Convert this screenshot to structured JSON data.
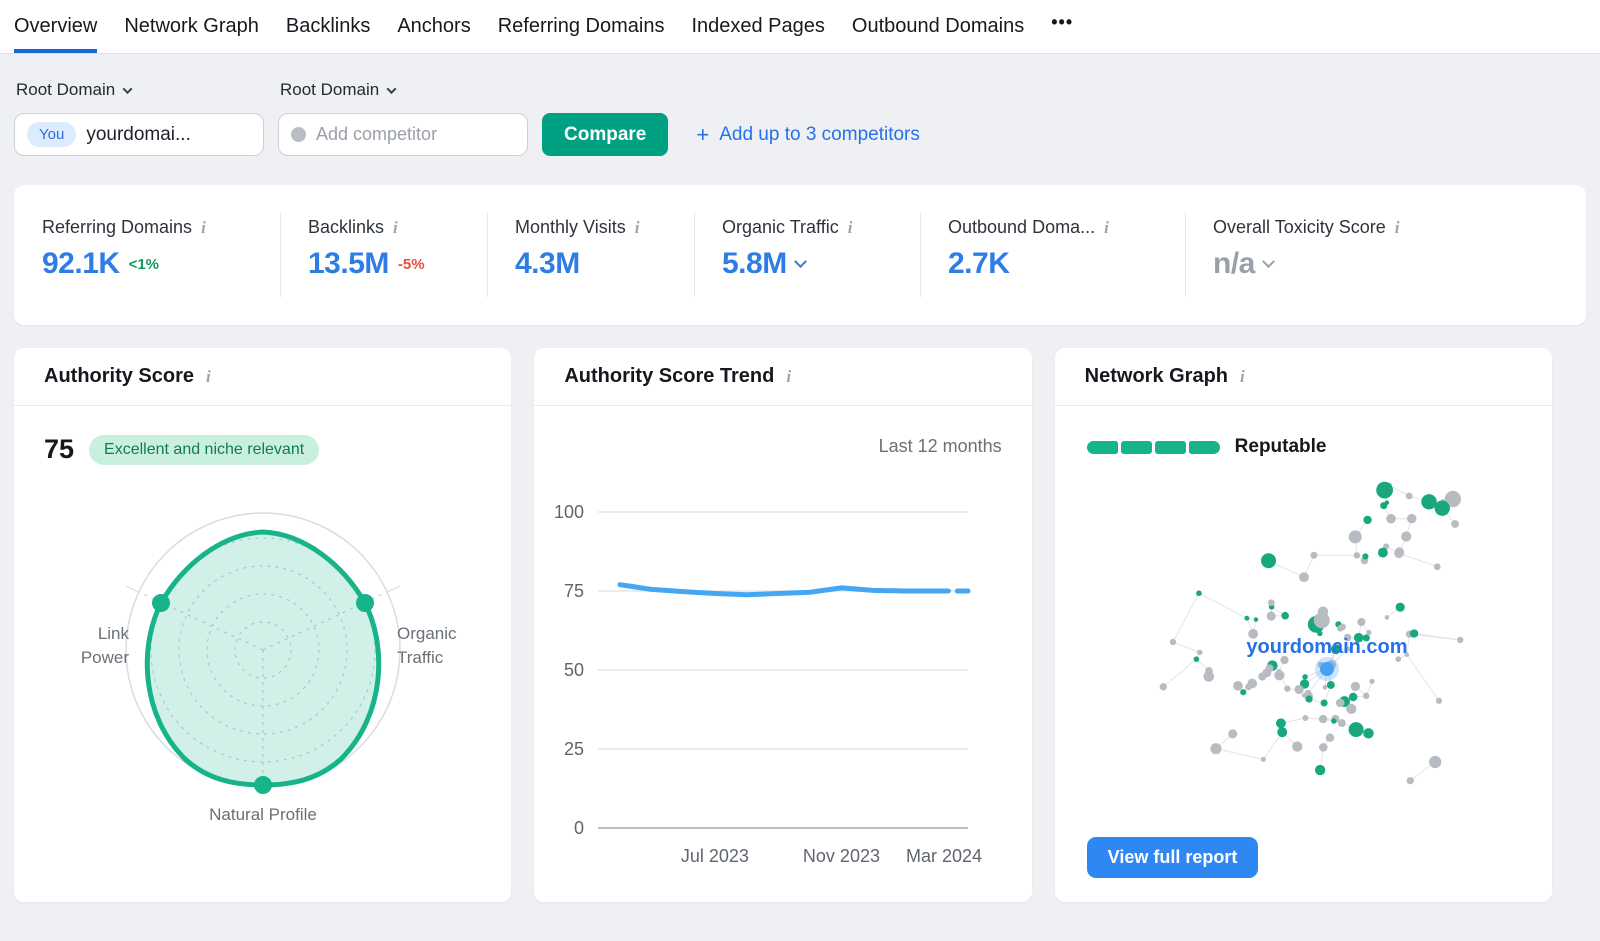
{
  "nav": {
    "tabs": [
      {
        "label": "Overview",
        "active": true
      },
      {
        "label": "Network Graph",
        "active": false
      },
      {
        "label": "Backlinks",
        "active": false
      },
      {
        "label": "Anchors",
        "active": false
      },
      {
        "label": "Referring Domains",
        "active": false
      },
      {
        "label": "Indexed Pages",
        "active": false
      },
      {
        "label": "Outbound Domains",
        "active": false
      }
    ],
    "more_label": "•••"
  },
  "filters": {
    "scope_label": "Root Domain",
    "competitor_scope_label": "Root Domain",
    "you_badge": "You",
    "your_domain_value": "yourdomai...",
    "competitor_placeholder": "Add competitor",
    "compare_button": "Compare",
    "add_plus": "+",
    "add_competitors_link": "Add up to 3 competitors"
  },
  "metrics": [
    {
      "label": "Referring Domains",
      "value": "92.1K",
      "delta": "<1%",
      "delta_color": "green",
      "muted": false,
      "dropdown": false
    },
    {
      "label": "Backlinks",
      "value": "13.5M",
      "delta": "-5%",
      "delta_color": "red",
      "muted": false,
      "dropdown": false
    },
    {
      "label": "Monthly Visits",
      "value": "4.3M",
      "delta": "",
      "delta_color": "",
      "muted": false,
      "dropdown": false
    },
    {
      "label": "Organic Traffic",
      "value": "5.8M",
      "delta": "",
      "delta_color": "",
      "muted": false,
      "dropdown": true
    },
    {
      "label": "Outbound Doma...",
      "value": "2.7K",
      "delta": "",
      "delta_color": "",
      "muted": false,
      "dropdown": false
    },
    {
      "label": "Overall Toxicity Score",
      "value": "n/a",
      "delta": "",
      "delta_color": "",
      "muted": true,
      "dropdown": true
    }
  ],
  "authority_card": {
    "title": "Authority Score",
    "score": "75",
    "badge": "Excellent and niche relevant"
  },
  "trend_card": {
    "title": "Authority Score Trend",
    "period_label": "Last 12 months"
  },
  "network_card": {
    "title": "Network Graph",
    "rating_label": "Reputable",
    "rating_segments": 4,
    "center_label": "yourdomain.com",
    "button": "View full report"
  },
  "chart_data": [
    {
      "type": "radar",
      "title": "Authority Score",
      "axes": [
        "Link Power",
        "Organic Traffic",
        "Natural Profile"
      ],
      "values": [
        80,
        80,
        98
      ],
      "max": 100,
      "grid": "dashed-circular"
    },
    {
      "type": "line",
      "title": "Authority Score Trend",
      "x": [
        "Apr 2023",
        "May 2023",
        "Jun 2023",
        "Jul 2023",
        "Aug 2023",
        "Sep 2023",
        "Oct 2023",
        "Nov 2023",
        "Dec 2023",
        "Jan 2024",
        "Feb 2024",
        "Mar 2024"
      ],
      "values": [
        77,
        75.5,
        74.8,
        74.2,
        73.8,
        74.2,
        74.6,
        76,
        75.2,
        75,
        75,
        75
      ],
      "dashed_tail_from_index": 10,
      "ylim": [
        0,
        100
      ],
      "yticks": [
        0,
        25,
        50,
        75,
        100
      ],
      "xtick_labels_shown": [
        "Jul 2023",
        "Nov 2023",
        "Mar 2024"
      ],
      "legend": "none",
      "grid": "horizontal"
    },
    {
      "type": "network",
      "title": "Network Graph",
      "center_node": "yourdomain.com",
      "rating": "Reputable",
      "node_kinds": [
        {
          "kind": "neutral",
          "color": "#b7bbc2"
        },
        {
          "kind": "reputable",
          "color": "#19a87d"
        },
        {
          "kind": "you",
          "color": "#45a0f6"
        }
      ]
    }
  ],
  "colors": {
    "accent_blue": "#2e7ce4",
    "link_blue": "#2670e8",
    "chart_line_blue": "#45a7f1",
    "underline_blue": "#1b64da",
    "button_blue": "#2f88f2",
    "green_button": "#00a082",
    "green_accent": "#17b389",
    "node_green": "#19a87d",
    "node_gray": "#b7bbc2",
    "badge_green_bg": "#c9efdf",
    "badge_green_text": "#127a5b",
    "delta_green": "#0e9b62",
    "delta_red": "#e9503f",
    "gray_text": "#6a7078",
    "tick_text": "#5f6570",
    "grid_line": "#e4e6ea",
    "axis_line": "#b9bdc4"
  }
}
